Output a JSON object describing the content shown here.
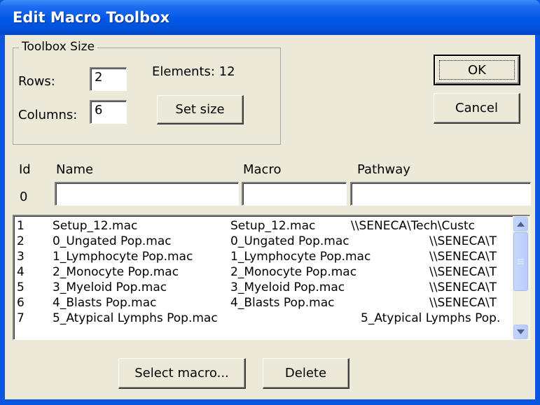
{
  "window": {
    "title": "Edit Macro Toolbox"
  },
  "toolbox_size": {
    "legend": "Toolbox Size",
    "rows_label": "Rows:",
    "rows_value": "2",
    "columns_label": "Columns:",
    "columns_value": "6",
    "elements_label": "Elements: 12",
    "set_size_label": "Set size"
  },
  "buttons": {
    "ok": "OK",
    "cancel": "Cancel",
    "select_macro": "Select macro...",
    "delete": "Delete"
  },
  "columns": {
    "id": "Id",
    "name": "Name",
    "macro": "Macro",
    "pathway": "Pathway"
  },
  "edit_row": {
    "id": "0",
    "name": "",
    "macro": "",
    "pathway": ""
  },
  "list": {
    "rows": [
      {
        "id": "1",
        "name": "Setup_12.mac",
        "macro": "Setup_12.mac",
        "pathway": "\\\\SENECA\\Tech\\Custc"
      },
      {
        "id": "2",
        "name": "0_Ungated Pop.mac",
        "macro": "0_Ungated Pop.mac",
        "pathway": "\\\\SENECA\\T"
      },
      {
        "id": "3",
        "name": "1_Lymphocyte Pop.mac",
        "macro": "1_Lymphocyte Pop.mac",
        "pathway": "\\\\SENECA\\T"
      },
      {
        "id": "4",
        "name": "2_Monocyte Pop.mac",
        "macro": "2_Monocyte Pop.mac",
        "pathway": "\\\\SENECA\\T"
      },
      {
        "id": "5",
        "name": "3_Myeloid Pop.mac",
        "macro": "3_Myeloid Pop.mac",
        "pathway": "\\\\SENECA\\T"
      },
      {
        "id": "6",
        "name": "4_Blasts Pop.mac",
        "macro": "4_Blasts Pop.mac",
        "pathway": "\\\\SENECA\\T"
      },
      {
        "id": "7",
        "name": "5_Atypical Lymphs Pop.mac",
        "macro": "",
        "pathway": "5_Atypical Lymphs Pop."
      }
    ]
  },
  "icons": {
    "scroll_up": "triangle-up",
    "scroll_down": "triangle-down",
    "thumb_grip": "grip-lines"
  },
  "colors": {
    "titlebar": "#0058e6",
    "face": "#ece9d8",
    "scroll_button": "#c4d5fc"
  }
}
